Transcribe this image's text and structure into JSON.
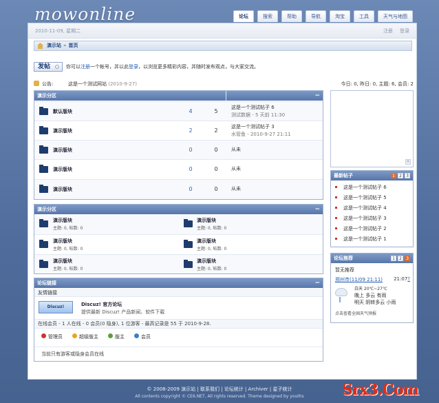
{
  "logo": "mowonline",
  "tabs": [
    "论坛",
    "搜索",
    "帮助",
    "导航",
    "淘宝",
    "工具",
    "天气与地图"
  ],
  "topline": {
    "date": "2010-11-09, 星期二",
    "login": "注册",
    "register": "登录"
  },
  "breadcrumb": {
    "site": "演示站",
    "current": "首页"
  },
  "post_button": "发帖",
  "login_msg": {
    "pre": "你可以",
    "register": "注册",
    "mid": "一个帐号，并以此",
    "login": "登录",
    "post": "，以浏览更多精彩内容，并随时发布观点，与大家交流。"
  },
  "announcement": {
    "label": "公告:",
    "text": "这是一个测试网站",
    "date": "(2010-9-27)"
  },
  "stats_text": "今日: 0, 昨日: 0, 主题: 6, 会员: 2",
  "cat1": {
    "title": "演示分区",
    "forums": [
      {
        "name": "默认版块",
        "topics": "4",
        "posts": "5",
        "last_title": "这是一个测试帖子 6",
        "last_info": "测试数据 - 5 天前 11:30"
      },
      {
        "name": "演示版块",
        "topics": "2",
        "posts": "2",
        "last_title": "这是一个测试帖子 3",
        "last_info": "水管鱼 - 2010-9-27 21:11"
      },
      {
        "name": "演示版块",
        "topics": "0",
        "posts": "0",
        "last_title": "从未",
        "last_info": ""
      },
      {
        "name": "演示版块",
        "topics": "0",
        "posts": "0",
        "last_title": "从未",
        "last_info": ""
      },
      {
        "name": "演示版块",
        "topics": "0",
        "posts": "0",
        "last_title": "从未",
        "last_info": ""
      }
    ]
  },
  "cat2": {
    "title": "演示分区",
    "forums": [
      {
        "name": "演示版块",
        "stats": "主题: 0, 帖数: 0"
      },
      {
        "name": "演示版块",
        "stats": "主题: 0, 帖数: 0"
      },
      {
        "name": "演示版块",
        "stats": "主题: 0, 帖数: 0"
      },
      {
        "name": "演示版块",
        "stats": "主题: 0, 帖数: 0"
      },
      {
        "name": "演示版块",
        "stats": "主题: 0, 帖数: 0"
      },
      {
        "name": "演示版块",
        "stats": "主题: 0, 帖数: 0"
      }
    ]
  },
  "links": {
    "title": "论坛链接",
    "sub": "友情链接",
    "logo_text": "Discuz!",
    "name": "Discuz! 官方论坛",
    "desc": "提供最新 Discuz! 产品新闻、软件下载"
  },
  "online": {
    "text": "在线会员 - 1 人在线 - 0 会员(0 隐身), 1 位游客 - 最高记录是 55 于 2010-9-28.",
    "legend": [
      "管理员",
      "超级版主",
      "版主",
      "会员"
    ],
    "footer": "当前只有游客或隐身会员在线"
  },
  "sidebar": {
    "new_posts_title": "最新帖子",
    "new_pages": [
      "1",
      "2",
      "3"
    ],
    "new_posts": [
      "这是一个测试帖子 6",
      "这是一个测试帖子 5",
      "这是一个测试帖子 4",
      "这是一个测试帖子 3",
      "这是一个测试帖子 2",
      "这是一个测试帖子 1"
    ],
    "rec_title": "论坛推荐",
    "rec_pages": [
      "1",
      "2",
      "3"
    ],
    "rec_sub": "暂无推荐",
    "weather_city": "郑州市",
    "weather_date": "(11/09 21:11)",
    "weather_time": "21:07",
    "weather_q": "?",
    "weather_day": "白天 20℃~27℃",
    "weather_night": "晚上 多云 有雨",
    "weather_next": "明天 阴转多云 小雨",
    "weather_link": "点击查看全国天气预报"
  },
  "footer": {
    "line1": "© 2008-2009  演示站  |  联系我们  |  论坛统计  |  Archiver  |  星子统计",
    "line2": "All contents copyright © CE6.NET, All rights reserved. Theme designed by youths"
  },
  "watermark": "Srx3.Com",
  "colors": {
    "header_blue": "#5776aa",
    "bg": "#5b78a6",
    "accent": "#e46b2c"
  }
}
